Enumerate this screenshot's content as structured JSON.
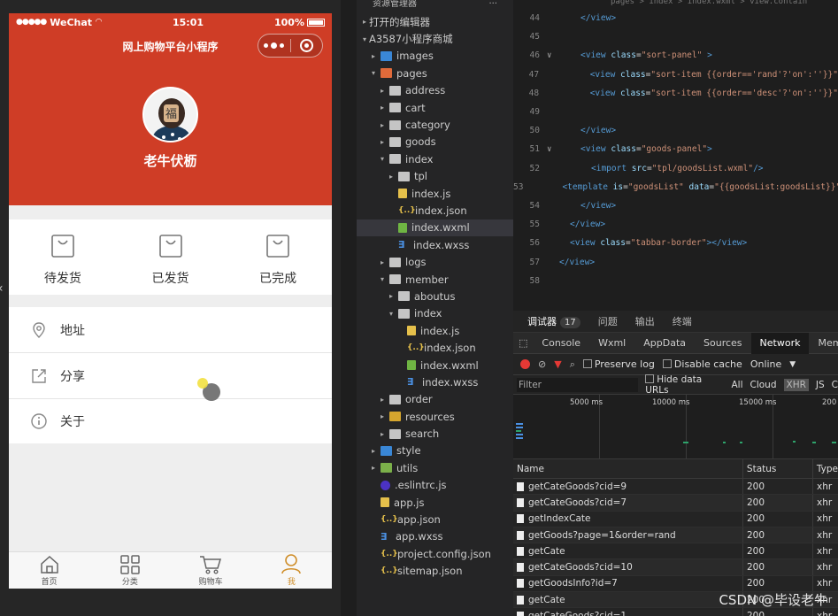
{
  "phone": {
    "status": {
      "carrier": "WeChat",
      "time": "15:01",
      "battery": "100%"
    },
    "nav_title": "网上购物平台小程序",
    "nickname": "老牛伏枥",
    "orders": [
      {
        "label": "待发货"
      },
      {
        "label": "已发货"
      },
      {
        "label": "已完成"
      }
    ],
    "menu": [
      {
        "label": "地址",
        "icon": "location-icon"
      },
      {
        "label": "分享",
        "icon": "share-icon"
      },
      {
        "label": "关于",
        "icon": "info-icon"
      }
    ],
    "tabs": [
      {
        "label": "首页",
        "icon": "home-icon"
      },
      {
        "label": "分类",
        "icon": "grid-icon"
      },
      {
        "label": "购物车",
        "icon": "cart-icon"
      },
      {
        "label": "我",
        "icon": "user-icon"
      }
    ]
  },
  "explorer": {
    "title": "资源管理器",
    "more": "···",
    "rows": [
      {
        "label": "打开的编辑器",
        "indent": 0,
        "arrow": "▸",
        "icon": ""
      },
      {
        "label": "A3587小程序商城",
        "indent": 0,
        "arrow": "▾",
        "icon": ""
      },
      {
        "label": "images",
        "indent": 1,
        "arrow": "▸",
        "icon": "folder-blue"
      },
      {
        "label": "pages",
        "indent": 1,
        "arrow": "▾",
        "icon": "folder-red"
      },
      {
        "label": "address",
        "indent": 2,
        "arrow": "▸",
        "icon": "folder"
      },
      {
        "label": "cart",
        "indent": 2,
        "arrow": "▸",
        "icon": "folder"
      },
      {
        "label": "category",
        "indent": 2,
        "arrow": "▸",
        "icon": "folder"
      },
      {
        "label": "goods",
        "indent": 2,
        "arrow": "▸",
        "icon": "folder"
      },
      {
        "label": "index",
        "indent": 2,
        "arrow": "▾",
        "icon": "folder"
      },
      {
        "label": "tpl",
        "indent": 3,
        "arrow": "▸",
        "icon": "folder"
      },
      {
        "label": "index.js",
        "indent": 3,
        "arrow": "",
        "icon": "js"
      },
      {
        "label": "index.json",
        "indent": 3,
        "arrow": "",
        "icon": "json"
      },
      {
        "label": "index.wxml",
        "indent": 3,
        "arrow": "",
        "icon": "wxml",
        "selected": true
      },
      {
        "label": "index.wxss",
        "indent": 3,
        "arrow": "",
        "icon": "wxss"
      },
      {
        "label": "logs",
        "indent": 2,
        "arrow": "▸",
        "icon": "folder"
      },
      {
        "label": "member",
        "indent": 2,
        "arrow": "▾",
        "icon": "folder"
      },
      {
        "label": "aboutus",
        "indent": 3,
        "arrow": "▸",
        "icon": "folder"
      },
      {
        "label": "index",
        "indent": 3,
        "arrow": "▾",
        "icon": "folder"
      },
      {
        "label": "index.js",
        "indent": 4,
        "arrow": "",
        "icon": "js"
      },
      {
        "label": "index.json",
        "indent": 4,
        "arrow": "",
        "icon": "json"
      },
      {
        "label": "index.wxml",
        "indent": 4,
        "arrow": "",
        "icon": "wxml"
      },
      {
        "label": "index.wxss",
        "indent": 4,
        "arrow": "",
        "icon": "wxss"
      },
      {
        "label": "order",
        "indent": 2,
        "arrow": "▸",
        "icon": "folder"
      },
      {
        "label": "resources",
        "indent": 2,
        "arrow": "▸",
        "icon": "folder-yellow"
      },
      {
        "label": "search",
        "indent": 2,
        "arrow": "▸",
        "icon": "folder"
      },
      {
        "label": "style",
        "indent": 1,
        "arrow": "▸",
        "icon": "folder-blue"
      },
      {
        "label": "utils",
        "indent": 1,
        "arrow": "▸",
        "icon": "folder-green"
      },
      {
        "label": ".eslintrc.js",
        "indent": 1,
        "arrow": "",
        "icon": "eslint"
      },
      {
        "label": "app.js",
        "indent": 1,
        "arrow": "",
        "icon": "js"
      },
      {
        "label": "app.json",
        "indent": 1,
        "arrow": "",
        "icon": "json"
      },
      {
        "label": "app.wxss",
        "indent": 1,
        "arrow": "",
        "icon": "wxss"
      },
      {
        "label": "project.config.json",
        "indent": 1,
        "arrow": "",
        "icon": "json"
      },
      {
        "label": "sitemap.json",
        "indent": 1,
        "arrow": "",
        "icon": "json"
      }
    ]
  },
  "editor": {
    "breadcrumb": "pages > index > index.wxml > view.contain",
    "lines": [
      {
        "n": "44",
        "fold": "",
        "indent": 2,
        "html": "<span class='tag'>&lt;/view&gt;</span>"
      },
      {
        "n": "45",
        "fold": "",
        "indent": 0,
        "html": ""
      },
      {
        "n": "46",
        "fold": "∨",
        "indent": 2,
        "html": "<span class='tag'>&lt;view</span> <span class='attr'>class</span><span class='txt'>=</span><span class='str'>\"sort-panel\"</span> <span class='tag'>&gt;</span>"
      },
      {
        "n": "47",
        "fold": "",
        "indent": 3,
        "html": "<span class='tag'>&lt;view</span> <span class='attr'>class</span><span class='txt'>=</span><span class='str'>\"sort-item {{order=='rand'?'on':''}}\"</span>"
      },
      {
        "n": "48",
        "fold": "",
        "indent": 3,
        "html": "<span class='tag'>&lt;view</span> <span class='attr'>class</span><span class='txt'>=</span><span class='str'>\"sort-item {{order=='desc'?'on':''}}\"</span>"
      },
      {
        "n": "49",
        "fold": "",
        "indent": 0,
        "html": ""
      },
      {
        "n": "50",
        "fold": "",
        "indent": 2,
        "html": "<span class='tag'>&lt;/view&gt;</span>"
      },
      {
        "n": "51",
        "fold": "∨",
        "indent": 2,
        "html": "<span class='tag'>&lt;view</span> <span class='attr'>class</span><span class='txt'>=</span><span class='str'>\"goods-panel\"</span><span class='tag'>&gt;</span>"
      },
      {
        "n": "52",
        "fold": "",
        "indent": 3,
        "html": "<span class='tag'>&lt;import</span> <span class='attr'>src</span><span class='txt'>=</span><span class='str'>\"tpl/goodsList.wxml\"</span><span class='tag'>/&gt;</span>"
      },
      {
        "n": "53",
        "fold": "",
        "indent": 3,
        "html": "<span class='tag'>&lt;template</span> <span class='attr'>is</span><span class='txt'>=</span><span class='str'>\"goodsList\"</span> <span class='attr'>data</span><span class='txt'>=</span><span class='str'>\"{{goodsList:goodsList}}\"</span>"
      },
      {
        "n": "54",
        "fold": "",
        "indent": 2,
        "html": "<span class='tag'>&lt;/view&gt;</span>"
      },
      {
        "n": "55",
        "fold": "",
        "indent": 1,
        "html": "<span class='tag'>&lt;/view&gt;</span>"
      },
      {
        "n": "56",
        "fold": "",
        "indent": 1,
        "html": "<span class='tag'>&lt;view</span> <span class='attr'>class</span><span class='txt'>=</span><span class='str'>\"tabbar-border\"</span><span class='tag'>&gt;&lt;/view&gt;</span>"
      },
      {
        "n": "57",
        "fold": "",
        "indent": 0,
        "html": "<span class='tag'>&lt;/view&gt;</span>"
      },
      {
        "n": "58",
        "fold": "",
        "indent": 0,
        "html": ""
      }
    ]
  },
  "devtools": {
    "top_tabs": [
      {
        "label": "调试器",
        "badge": "17",
        "on": true
      },
      {
        "label": "问题"
      },
      {
        "label": "输出"
      },
      {
        "label": "终端"
      }
    ],
    "tabs": [
      "Console",
      "Wxml",
      "AppData",
      "Sources",
      "Network",
      "Memory"
    ],
    "active_tab": "Network",
    "preserve_log": "Preserve log",
    "disable_cache": "Disable cache",
    "throttle": "Online",
    "filter_placeholder": "Filter",
    "hide_data_urls": "Hide data URLs",
    "filter_types": [
      "All",
      "Cloud",
      "XHR",
      "JS",
      "C"
    ],
    "timeline_labels": [
      "5000 ms",
      "10000 ms",
      "15000 ms",
      "200"
    ],
    "columns": {
      "name": "Name",
      "status": "Status",
      "type": "Type"
    },
    "requests": [
      {
        "name": "getCateGoods?cid=9",
        "status": "200",
        "type": "xhr"
      },
      {
        "name": "getCateGoods?cid=7",
        "status": "200",
        "type": "xhr"
      },
      {
        "name": "getIndexCate",
        "status": "200",
        "type": "xhr"
      },
      {
        "name": "getGoods?page=1&order=rand",
        "status": "200",
        "type": "xhr"
      },
      {
        "name": "getCate",
        "status": "200",
        "type": "xhr"
      },
      {
        "name": "getCateGoods?cid=10",
        "status": "200",
        "type": "xhr"
      },
      {
        "name": "getGoodsInfo?id=7",
        "status": "200",
        "type": "xhr"
      },
      {
        "name": "getCate",
        "status": "200",
        "type": "xhr"
      },
      {
        "name": "getCateGoods?cid=1",
        "status": "200",
        "type": "xhr"
      }
    ]
  },
  "watermark": "CSDN @毕设老牛",
  "colors": {
    "brand": "#cf3d26",
    "tab_active": "#cf8e2a"
  }
}
